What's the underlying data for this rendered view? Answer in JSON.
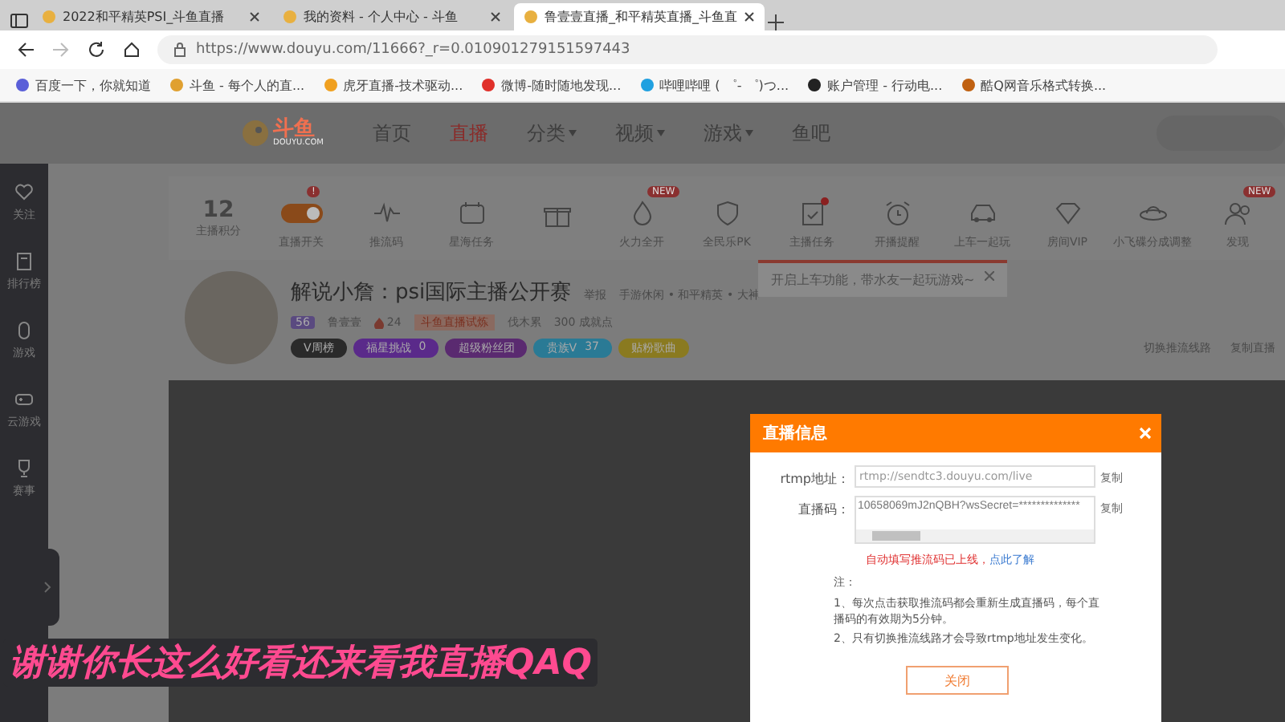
{
  "browser": {
    "tabs": [
      {
        "title": "2022和平精英PSI_斗鱼直播",
        "selected": false
      },
      {
        "title": "我的资料 - 个人中心 - 斗鱼",
        "selected": false
      },
      {
        "title": "鲁壹壹直播_和平精英直播_斗鱼直",
        "selected": true
      }
    ],
    "url": "https://www.douyu.com/11666?_r=0.010901279151597443",
    "bookmarks": [
      {
        "title": "百度一下，你就知道",
        "color": "#5a5fd8"
      },
      {
        "title": "斗鱼 - 每个人的直...",
        "color": "#e0a030"
      },
      {
        "title": "虎牙直播-技术驱动...",
        "color": "#f0a020"
      },
      {
        "title": "微博-随时随地发现...",
        "color": "#e0302a"
      },
      {
        "title": "哔哩哔哩 ( ゜- ゜)つ...",
        "color": "#20a0e0"
      },
      {
        "title": "账户管理 - 行动电...",
        "color": "#222222"
      },
      {
        "title": "酷Q网音乐格式转换...",
        "color": "#c06010"
      }
    ]
  },
  "header": {
    "logo": {
      "text": "斗鱼",
      "subtext": "DOUYU.COM"
    },
    "nav": [
      {
        "label": "首页",
        "selected": false,
        "dropdown": false
      },
      {
        "label": "直播",
        "selected": true,
        "dropdown": false
      },
      {
        "label": "分类",
        "selected": false,
        "dropdown": true
      },
      {
        "label": "视频",
        "selected": false,
        "dropdown": true
      },
      {
        "label": "游戏",
        "selected": false,
        "dropdown": true
      },
      {
        "label": "鱼吧",
        "selected": false,
        "dropdown": false
      }
    ]
  },
  "sidebar": {
    "items": [
      "关注",
      "排行榜",
      "游戏",
      "云游戏",
      "赛事"
    ]
  },
  "toolbar": {
    "score": {
      "value": "12",
      "label": "主播积分"
    },
    "tools": [
      {
        "label": "直播开关",
        "kind": "toggle",
        "on": true,
        "badge": "!",
        "dot": false
      },
      {
        "label": "推流码",
        "kind": "icon",
        "dot": false
      },
      {
        "label": "星海任务",
        "kind": "icon",
        "dot": false
      },
      {
        "kind": "icon",
        "dot": false
      },
      {
        "label": "火力全开",
        "kind": "icon",
        "badge": "NEW",
        "dot": false
      },
      {
        "label": "全民乐PK",
        "kind": "icon",
        "dot": false
      },
      {
        "label": "主播任务",
        "kind": "icon",
        "dot": true
      },
      {
        "label": "开播提醒",
        "kind": "icon",
        "dot": false
      },
      {
        "label": "上车一起玩",
        "kind": "icon",
        "dot": false
      },
      {
        "label": "房间VIP",
        "kind": "icon",
        "dot": false
      },
      {
        "label": "小飞碟分成调整",
        "kind": "icon",
        "dot": false
      },
      {
        "label": "发现",
        "kind": "icon",
        "badge": "NEW",
        "dot": false
      }
    ],
    "tooltip": "开启上车功能，带水友一起玩游戏~"
  },
  "streamer": {
    "title": "解说小詹：psi国际主播公开赛",
    "report": "举报",
    "category": "手游休闲 • 和平精英 • 大神",
    "level": "56",
    "name": "鲁壹壹",
    "heat": "24",
    "medal": "斗鱼直播试炼",
    "family": "伐木累",
    "achievement": "300 成就点",
    "chips": [
      {
        "label": "V周榜",
        "color": "#2a2a2a"
      },
      {
        "label": "福星挑战",
        "count": "0",
        "color": "#5a2a8a"
      },
      {
        "label": "超级粉丝团",
        "color": "#5a2a70"
      },
      {
        "label": "贵族V",
        "count": "37",
        "color": "#2a7a95"
      },
      {
        "label": "贴粉歌曲",
        "color": "#8a7a20"
      }
    ],
    "actions": [
      "切换推流线路",
      "复制直播"
    ]
  },
  "modal": {
    "title": "直播信息",
    "rows": [
      {
        "label": "rtmp地址：",
        "value": "rtmp://sendtc3.douyu.com/live",
        "copy": "复制",
        "kind": "input"
      },
      {
        "label": "直播码：",
        "value": "10658069mJ2nQBH?wsSecret=**************",
        "copy": "复制",
        "kind": "textarea"
      }
    ],
    "notice": "自动填写推流码已上线，",
    "notice_link": "点此了解",
    "note_title": "注：",
    "notes": [
      "1、每次点击获取推流码都会重新生成直播码，每个直播码的有效期为5分钟。",
      "2、只有切换推流线路才会导致rtmp地址发生变化。"
    ],
    "close": "关闭"
  },
  "caption": "谢谢你长这么好看还来看我直播QAQ"
}
